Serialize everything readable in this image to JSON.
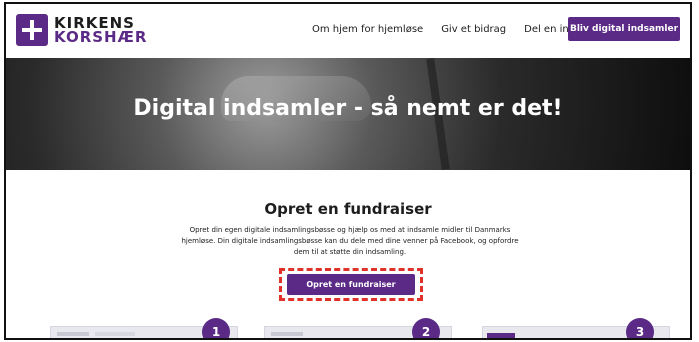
{
  "brand": {
    "line1": "KIRKENS",
    "line2": "KORSHÆR",
    "accent": "#5b2a86"
  },
  "nav": {
    "items": [
      {
        "label": "Om hjem for hjemløse"
      },
      {
        "label": "Giv et bidrag"
      },
      {
        "label": "Del en indsamling"
      }
    ],
    "cta_label": "Bliv digital indsamler"
  },
  "hero": {
    "title": "Digital indsamler - så nemt er det!"
  },
  "main": {
    "title": "Opret en fundraiser",
    "description": "Opret din egen digitale indsamlingsbøsse og hjælp os med at indsamle midler til Danmarks hjemløse. Din digitale indsamlingsbøsse kan du dele med dine venner på Facebook, og opfordre dem til at støtte din indsamling.",
    "cta_label": "Opret en fundraiser",
    "highlight_color": "#e0312a"
  },
  "steps": [
    {
      "number": "1"
    },
    {
      "number": "2"
    },
    {
      "number": "3"
    }
  ]
}
